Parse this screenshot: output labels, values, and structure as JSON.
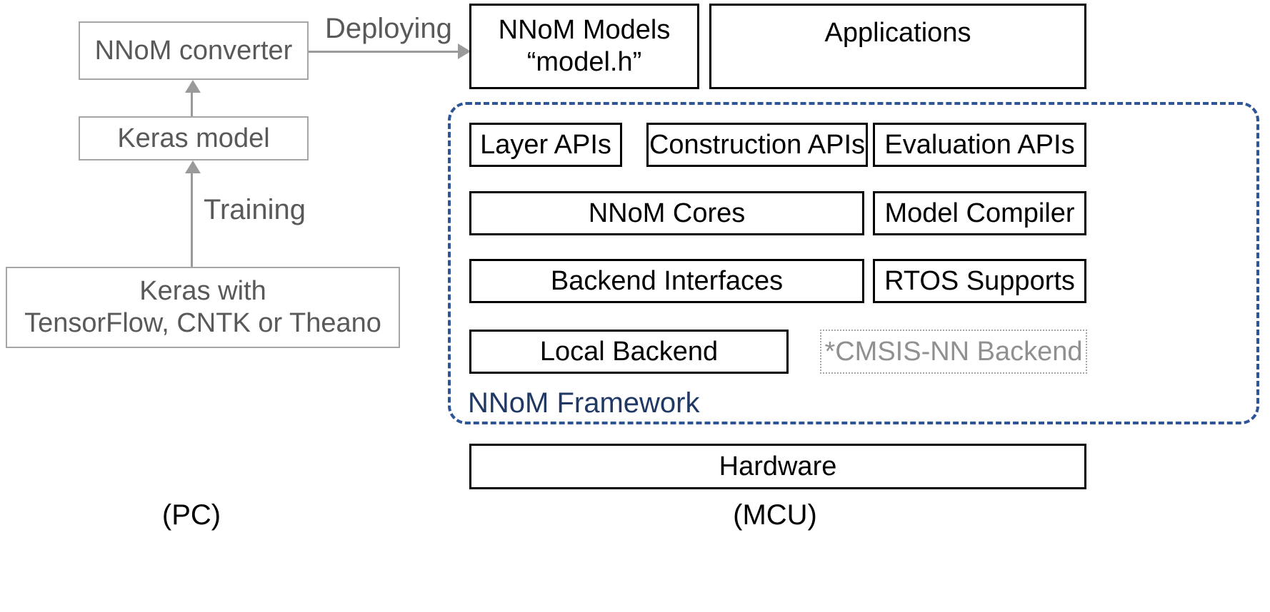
{
  "diagram": {
    "title": "NNoM framework architecture overview",
    "colors": {
      "pc_border": "#a6a6a6",
      "pc_text": "#595959",
      "mcu_border": "#000000",
      "mcu_text": "#000000",
      "framework_border": "#2e5597",
      "framework_text": "#1f3864",
      "optional_border": "#a6a6a6",
      "optional_text": "#909090",
      "arrow": "#9a9a9a",
      "background": "#ffffff"
    }
  },
  "pc_side": {
    "label": "(PC)",
    "boxes": {
      "converter": "NNoM converter",
      "keras_model": "Keras model",
      "training_source_line1": "Keras with",
      "training_source_line2": "TensorFlow, CNTK or Theano"
    },
    "arrows": {
      "training": "Training"
    }
  },
  "bridge": {
    "deploying": "Deploying"
  },
  "mcu_side": {
    "label": "(MCU)",
    "top_row": {
      "models_line1": "NNoM Models",
      "models_line2": "“model.h”",
      "applications": "Applications"
    },
    "framework": {
      "label": "NNoM Framework",
      "api_row": [
        "Layer APIs",
        "Construction APIs",
        "Evaluation APIs"
      ],
      "row2": {
        "left": "NNoM Cores",
        "right": "Model Compiler"
      },
      "row3": {
        "left": "Backend Interfaces",
        "right": "RTOS Supports"
      },
      "row4": {
        "left": "Local Backend",
        "right": "*CMSIS-NN Backend"
      }
    },
    "hardware": "Hardware"
  }
}
